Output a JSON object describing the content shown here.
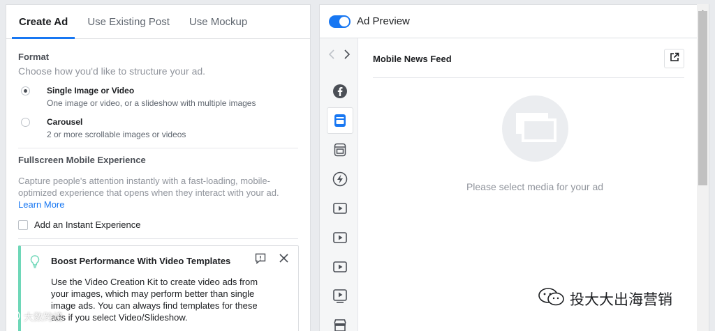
{
  "tabs": [
    "Create Ad",
    "Use Existing Post",
    "Use Mockup"
  ],
  "format": {
    "title": "Format",
    "subtitle": "Choose how you'd like to structure your ad.",
    "options": [
      {
        "label": "Single Image or Video",
        "desc": "One image or video, or a slideshow with multiple images",
        "checked": true
      },
      {
        "label": "Carousel",
        "desc": "2 or more scrollable images or videos",
        "checked": false
      }
    ]
  },
  "fullscreen": {
    "title": "Fullscreen Mobile Experience",
    "body": "Capture people's attention instantly with a fast-loading, mobile-optimized experience that opens when they interact with your ad.",
    "learn_more": "Learn More",
    "checkbox_label": "Add an Instant Experience"
  },
  "boost": {
    "title": "Boost Performance With Video Templates",
    "body": "Use the Video Creation Kit to create video ads from your images, which may perform better than single image ads. You can always find templates for these ads if you select Video/Slideshow."
  },
  "preview": {
    "toggle_label": "Ad Preview",
    "title": "Mobile News Feed",
    "empty_text": "Please select media for your ad"
  },
  "placements": [
    "facebook-icon",
    "mobile-feed-icon",
    "desktop-feed-icon",
    "instant-articles-icon",
    "video-icon",
    "video-icon",
    "video-icon",
    "stories-icon",
    "marketplace-icon"
  ],
  "watermarks": {
    "left": "大数跨境",
    "right": "投大大出海营销"
  },
  "colors": {
    "accent": "#1877f2",
    "boost_border": "#6ed7b8"
  }
}
